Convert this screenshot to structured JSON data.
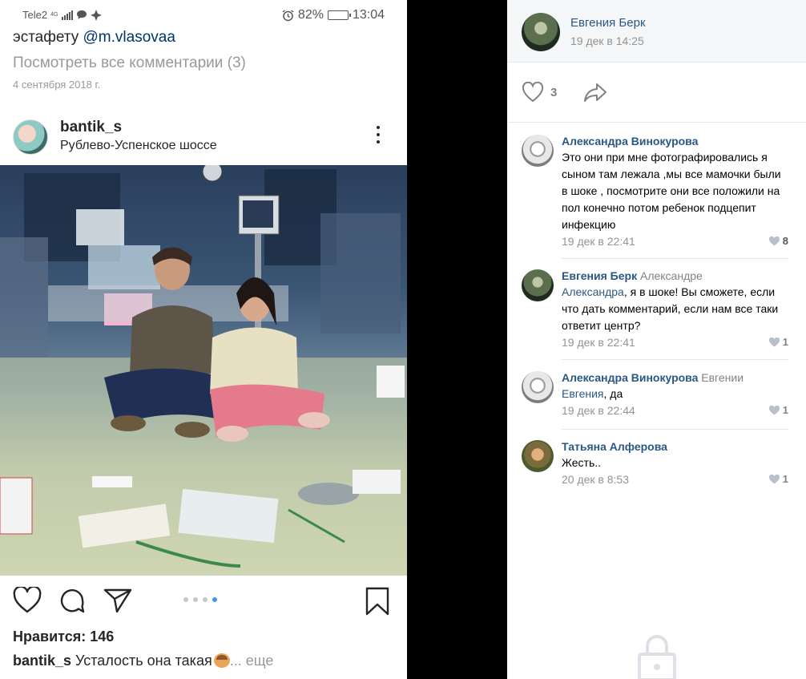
{
  "instagram": {
    "status_bar": {
      "carrier": "Tele2",
      "network": "4G",
      "battery": "82%",
      "battery_level": 0.82,
      "time": "13:04"
    },
    "prev_post": {
      "caption_text": "эстафету ",
      "caption_mention": "@m.vlasovaa",
      "view_comments": "Посмотреть все комментарии (3)",
      "date": "4 сентября 2018 г."
    },
    "post": {
      "username": "bantik_s",
      "location": "Рублево-Успенское шоссе",
      "likes": "Нравится: 146",
      "caption_user": "bantik_s",
      "caption_text": " Усталость она такая",
      "caption_more": "... еще",
      "carousel_pages": 4,
      "carousel_active": 4
    },
    "icons": [
      "heart-icon",
      "comment-icon",
      "send-icon",
      "bookmark-icon",
      "more-vertical-icon"
    ]
  },
  "vk": {
    "author": {
      "name": "Евгения Берк",
      "time": "19 дек в 14:25"
    },
    "likes_count": "3",
    "comments": [
      {
        "name": "Александра Винокурова",
        "reply_to": "",
        "ref": "",
        "text": "Это они при мне фотографировались я сыном там лежала ,мы все мамочки были в шоке , посмотрите они все положили на пол конечно потом ребенок подцепит инфекцию",
        "date": "19 дек в 22:41",
        "likes": "8"
      },
      {
        "name": "Евгения Берк",
        "reply_to": " Александре",
        "ref": "Александра",
        "text": ", я в шоке! Вы сможете, если что дать комментарий, если нам все таки ответит центр?",
        "date": "19 дек в 22:41",
        "likes": "1"
      },
      {
        "name": "Александра Винокурова",
        "reply_to": " Евгении",
        "ref": "Евгения",
        "text": ", да",
        "date": "19 дек в 22:44",
        "likes": "1"
      },
      {
        "name": "Татьяна Алферова",
        "reply_to": "",
        "ref": "",
        "text": "Жесть..",
        "date": "20 дек в 8:53",
        "likes": "1"
      }
    ]
  }
}
